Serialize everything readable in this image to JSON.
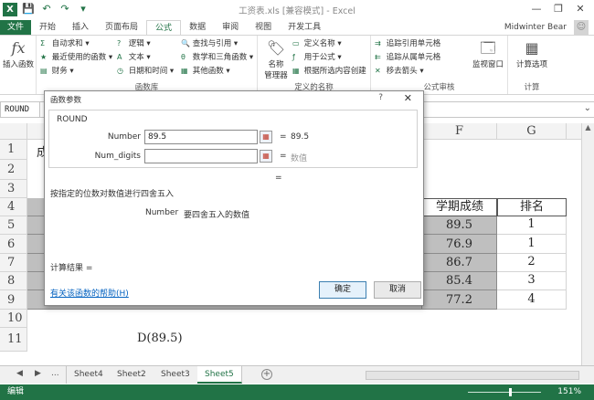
{
  "window": {
    "title": "工资表.xls [兼容模式] - Excel",
    "app_icon": "X",
    "minimize": "—",
    "restore": "❐",
    "close": "✕"
  },
  "qat": {
    "save": "💾",
    "undo": "↶",
    "redo": "↷",
    "more": "▾"
  },
  "ribbon_tabs": {
    "file": "文件",
    "items": [
      "开始",
      "插入",
      "页面布局",
      "公式",
      "数据",
      "审阅",
      "视图",
      "开发工具"
    ],
    "active": "公式"
  },
  "user": {
    "name": "Midwinter Bear",
    "avatar": "☺"
  },
  "ribbon": {
    "insert_function": "插入函数",
    "fx": "fx",
    "autosum": "自动求和",
    "recent": "最近使用的函数",
    "financial": "财务",
    "logical": "逻辑",
    "text": "文本",
    "datetime": "日期和时间",
    "lookup": "查找与引用",
    "math": "数学和三角函数",
    "other": "其他函数",
    "group_library": "函数库",
    "name_manager": "名称管理器",
    "name_manager_l1": "名称",
    "name_manager_l2": "管理器",
    "define_name": "定义名称",
    "use_in_formula": "用于公式",
    "create_from_sel": "根据所选内容创建",
    "group_names": "定义的名称",
    "trace_prec": "追踪引用单元格",
    "trace_dep": "追踪从属单元格",
    "remove_arrows": "移去箭头",
    "watch": "监视窗口",
    "group_audit": "公式审核",
    "calc_options": "计算选项",
    "group_calc": "计算"
  },
  "namebox": "ROUND",
  "columns": [
    "F",
    "G"
  ],
  "rows": [
    "1",
    "2",
    "3",
    "4",
    "5",
    "6",
    "7",
    "8",
    "9",
    "10",
    "11"
  ],
  "cells": {
    "a1_partial": "成",
    "header_score": "学期成绩",
    "header_rank": "排名",
    "scores": [
      "89.5",
      "76.9",
      "86.7",
      "85.4",
      "77.2"
    ],
    "ranks": [
      "1",
      "1",
      "2",
      "3",
      "4"
    ],
    "row11_formula": "D(89.5)"
  },
  "sheets": {
    "ellipsis": "...",
    "items": [
      "Sheet4",
      "Sheet2",
      "Sheet3",
      "Sheet5"
    ],
    "active": "Sheet5",
    "add": "+"
  },
  "status": {
    "mode": "编辑",
    "zoom": "151%"
  },
  "dialog": {
    "title": "函数参数",
    "help_icon": "?",
    "close_icon": "✕",
    "function_name": "ROUND",
    "args": [
      {
        "label": "Number",
        "value": "89.5",
        "result": "89.5"
      },
      {
        "label": "Num_digits",
        "value": "",
        "result": "数值"
      }
    ],
    "equals": "=",
    "description": "按指定的位数对数值进行四舍五入",
    "arg_desc_name": "Number",
    "arg_desc_text": "要四舍五入的数值",
    "result_label": "计算结果 =",
    "help_link": "有关该函数的帮助(H)",
    "ok": "确定",
    "cancel": "取消"
  },
  "colors": {
    "accent": "#217346",
    "link": "#0563c1"
  }
}
